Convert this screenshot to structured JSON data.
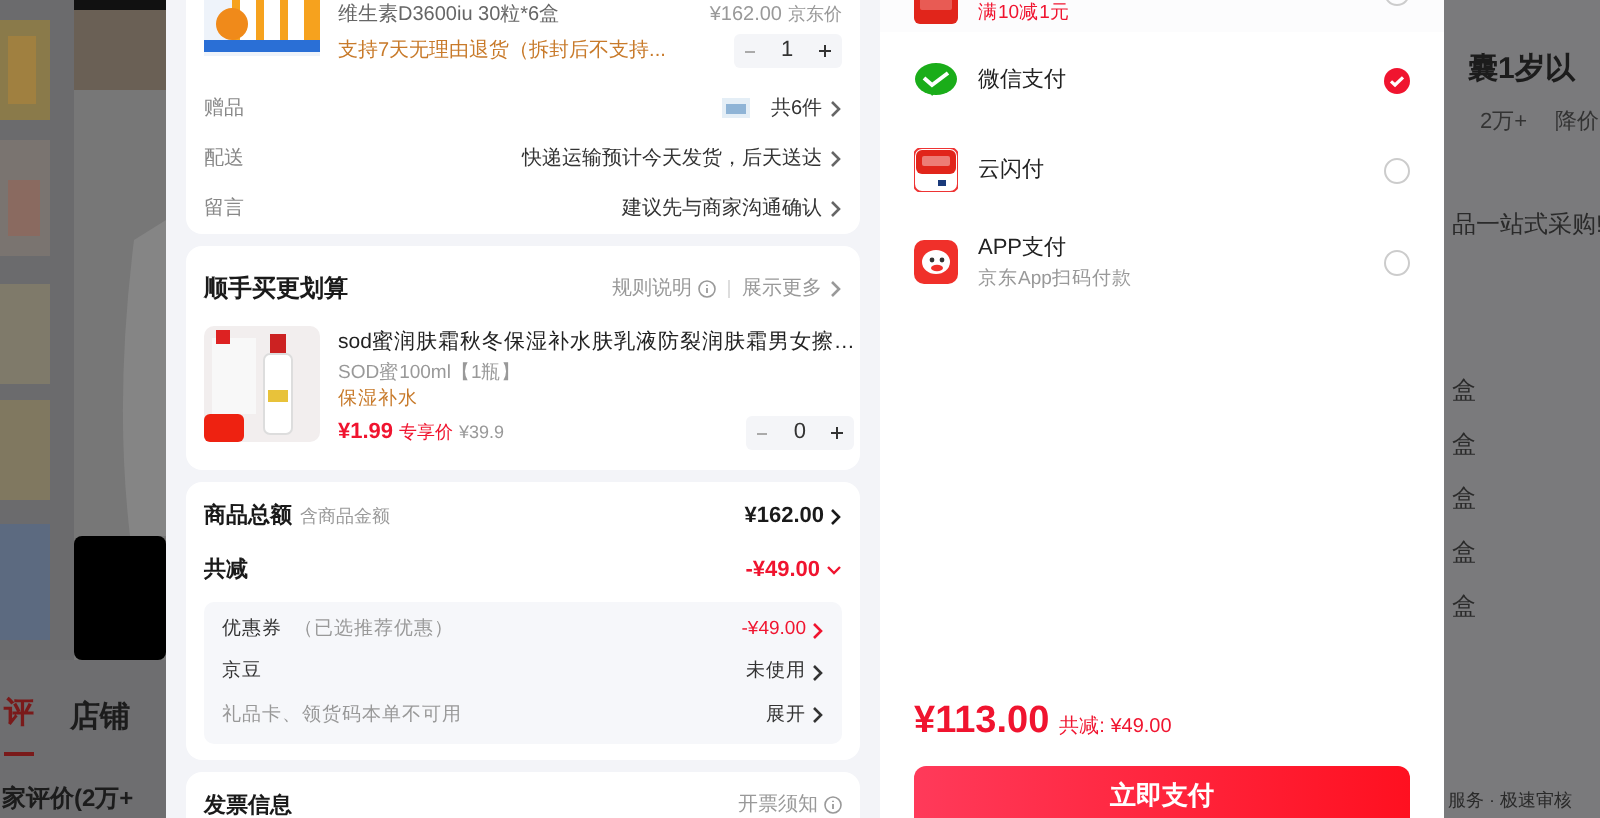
{
  "background_page": {
    "left_tabs": [
      {
        "label": "评",
        "selected": true
      },
      {
        "label": "店铺",
        "selected": false
      }
    ],
    "left_heading": "家评价(2万+",
    "right_texts": [
      {
        "text": "囊1岁以",
        "kind": "title"
      },
      {
        "text": "2万+",
        "kind": "meta"
      },
      {
        "text": "降价",
        "kind": "meta"
      },
      {
        "text": "品一站式采购!",
        "kind": "line"
      },
      {
        "text": "盒",
        "kind": "line"
      },
      {
        "text": "盒",
        "kind": "line"
      },
      {
        "text": "盒",
        "kind": "line"
      },
      {
        "text": "盒",
        "kind": "line"
      },
      {
        "text": "盒",
        "kind": "line"
      },
      {
        "text": "服务 · 极速审核",
        "kind": "footer"
      }
    ]
  },
  "order": {
    "product": {
      "spec": "维生素D3600iu 30粒*6盒",
      "price": "¥162.00",
      "price_label": "京东价",
      "return_note": "支持7天无理由退货（拆封后不支持...",
      "quantity": "1"
    },
    "rows": [
      {
        "label": "赠品",
        "value": "共6件",
        "kind": "gift"
      },
      {
        "label": "配送",
        "value": "快递运输预计今天发货，后天送达",
        "kind": "text"
      },
      {
        "label": "留言",
        "value": "建议先与商家沟通确认",
        "kind": "text"
      }
    ],
    "addon": {
      "title": "顺手买更划算",
      "rules_link": "规则说明",
      "more_link": "展示更多",
      "item": {
        "name": "sod蜜润肤霜秋冬保湿补水肤乳液防裂润肤霜男女擦…",
        "spec": "SOD蜜100ml【1瓶】",
        "tag": "保湿补水",
        "price": "¥1.99",
        "price_label": "专享价",
        "original_price": "¥39.9",
        "quantity": "0"
      }
    },
    "summary": {
      "total_label": "商品总额",
      "total_note": "含商品金额",
      "total_value": "¥162.00",
      "discount_label": "共减",
      "discount_value": "-¥49.00",
      "expanded": true,
      "details": [
        {
          "label": "优惠券",
          "note": "（已选推荐优惠）",
          "value": "-¥49.00",
          "kind": "discount"
        },
        {
          "label": "京豆",
          "value": "未使用",
          "kind": "plain"
        },
        {
          "label": "礼品卡、领货码本单不可用",
          "value": "展开",
          "kind": "muted"
        }
      ]
    },
    "invoice": {
      "title": "发票信息",
      "link": "开票须知"
    }
  },
  "payment": {
    "methods": [
      {
        "kind": "jdpay",
        "subtitle": "满10减1元",
        "selected": false
      },
      {
        "kind": "wechat",
        "title": "微信支付",
        "selected": true
      },
      {
        "kind": "unionpay",
        "title": "云闪付",
        "selected": false
      },
      {
        "kind": "app",
        "title": "APP支付",
        "subtitle": "京东App扫码付款",
        "selected": false
      }
    ],
    "total": "¥113.00",
    "discount": "共减: ¥49.00",
    "pay_button": "立即支付"
  }
}
